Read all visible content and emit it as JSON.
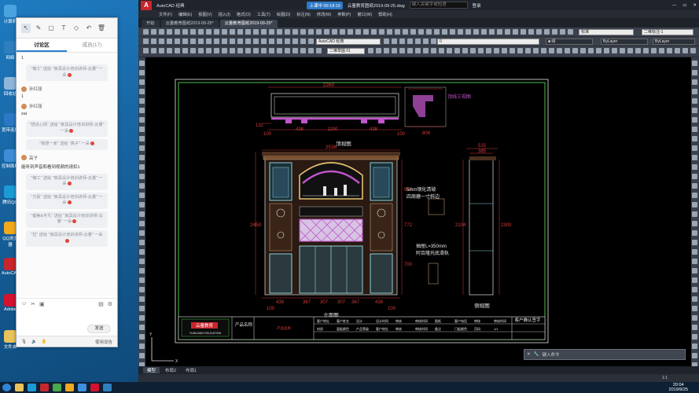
{
  "desktop": {
    "icons": [
      {
        "label": "计算机",
        "color": "#4aa3df"
      },
      {
        "label": "网络",
        "color": "#2f7fbf"
      },
      {
        "label": "回收站",
        "color": "#8fb6d8"
      },
      {
        "label": "宽带连接",
        "color": "#2b78c4"
      },
      {
        "label": "控制面板",
        "color": "#3c8dd6"
      },
      {
        "label": "腾讯QQ",
        "color": "#1b9bd6"
      },
      {
        "label": "QQ浏览器",
        "color": "#f0a81c"
      },
      {
        "label": "AutoCAD",
        "color": "#c8262d"
      },
      {
        "label": "Adobe",
        "color": "#d3122f"
      },
      {
        "label": "文件夹",
        "color": "#e8c35a"
      }
    ]
  },
  "chat": {
    "tabs": [
      "讨论区",
      "成员(17)"
    ],
    "messages": [
      {
        "kind": "plain",
        "text": "1"
      },
      {
        "kind": "sys",
        "text": "\"微工\" 送给 \"家具设计培训讲师-云量\" 一朵"
      },
      {
        "kind": "user",
        "name": "孙红丽"
      },
      {
        "kind": "plain",
        "text": "1"
      },
      {
        "kind": "user",
        "name": "孙红丽"
      },
      {
        "kind": "plain",
        "text": "zai"
      },
      {
        "kind": "sys",
        "text": "\"想说心情\" 送给 \"家具设计培训讲师-云量\" 一朵"
      },
      {
        "kind": "sys",
        "text": "\"我想一家\" 送给 \"高子\" 一朵"
      },
      {
        "kind": "user",
        "name": "高子"
      },
      {
        "kind": "plain",
        "text": "能听到声音和看到视频的请扣1"
      },
      {
        "kind": "sys",
        "text": "\"微工\" 送给 \"家具设计培训讲师-云量\" 一朵"
      },
      {
        "kind": "sys",
        "text": "\"方民\" 送给 \"家具设计培训讲师-云量\" 一朵"
      },
      {
        "kind": "sys",
        "text": "\"健美&平凡\" 送给 \"家具设计培训讲师-云量\" 一朵"
      },
      {
        "kind": "sys",
        "text": "\"拉\" 送给 \"家具设计培训讲师-云量\" 一朵"
      }
    ],
    "send_label": "发送",
    "bottom_label": "使用设告"
  },
  "cad": {
    "app_name": "AutoCAD 经典",
    "upload": "上课中 00:18:15",
    "file_title": "云量教育图纸2019-09-25.dwg",
    "search_placeholder": "键入关键字或短语",
    "login": "登录",
    "menus": [
      "文件(F)",
      "编辑(E)",
      "视图(V)",
      "插入(I)",
      "格式(O)",
      "工具(T)",
      "绘图(D)",
      "标注(N)",
      "修改(M)",
      "参数(P)",
      "窗口(W)",
      "帮助(H)"
    ],
    "doc_tabs": [
      "开始",
      "云量教育图纸2019-09-25*",
      "云量教育图纸2019-09-25*"
    ],
    "layer_combo": "二维草图 01",
    "workspace_combo": "AutoCAD 经典",
    "layer_name": "0",
    "color_combo": "■ 绿",
    "linetype": "ByLayer",
    "lineweight": "ByLayer",
    "style1": "标准",
    "style2": "二维标注-1",
    "cmd_placeholder": "键入命令",
    "layout_tabs": [
      "模型",
      "布局2",
      "布局1"
    ],
    "status": "1:1"
  },
  "drawing": {
    "top_view": "顶视图",
    "front_view": "立面图",
    "side_view": "侧视图",
    "detail_label": "顶线三视图",
    "note1": "5mm钢化清玻",
    "note2": "四周磨一寸斜边",
    "note3": "抽屉L=350mm",
    "note4": "阿百隆托底滑轨",
    "dims": {
      "w2260": "2260",
      "w2536": "2536",
      "w515": "515",
      "w385": "385",
      "w438": "438",
      "w1100": "1100",
      "w100": "100",
      "w132": "132",
      "h2450": "2450",
      "h2300": "2300",
      "w367": "367",
      "w307": "307",
      "h950": "950",
      "h772": "772",
      "h580": "580",
      "h700": "700",
      "h860": "860",
      "h2300b": "2300",
      "h2104": "2104",
      "h390": "390",
      "w560": "560",
      "d804": "804"
    },
    "title_block": {
      "logo_text": "云量教育",
      "logo_sub": "YUNLIANG EDUCATION",
      "product_name_label": "产品名称",
      "product_name": "产品名称",
      "cells": [
        "客户地址",
        "客户姓名",
        "设计",
        "设计时间",
        "审核",
        "审核时间",
        "图纸",
        "客户电话",
        "审核",
        "审核时间",
        "材质",
        "面板颜色",
        "产品等级",
        "客户地址",
        "审核",
        "审核时间",
        "备注",
        "门板颜色",
        "页码",
        "1/1"
      ],
      "customer_sign": "客户确认签字"
    }
  },
  "taskbar": {
    "time": "20:04",
    "date": "2019/9/25"
  }
}
